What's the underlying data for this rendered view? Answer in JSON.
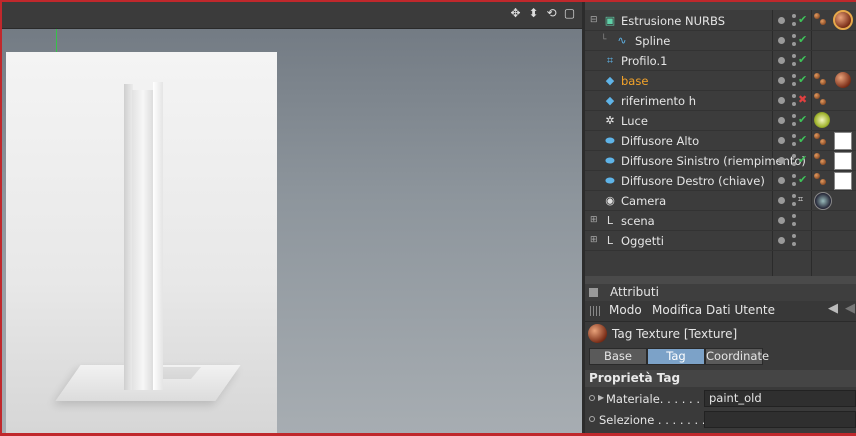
{
  "colors": {
    "window_border": "#c0282c",
    "active_object_text": "#f3a32a",
    "check_green": "#3ec45a",
    "x_red": "#e04040",
    "active_tab": "#7ca2c8"
  },
  "viewport": {
    "toolbar_icons": [
      "move-icon",
      "scale-icon",
      "rotate-icon",
      "maximize-icon"
    ]
  },
  "object_manager": {
    "rows": [
      {
        "name": "Estrusione NURBS",
        "icon": "extrude-nurbs-icon",
        "visible_check": true,
        "tags": [
          "phong-tag",
          "texture-tag-selected"
        ]
      },
      {
        "name": "Spline",
        "icon": "spline-icon",
        "visible_check": true,
        "tags": []
      },
      {
        "name": "Profilo.1",
        "icon": "profile-spline-icon",
        "visible_check": true,
        "tags": []
      },
      {
        "name": "base",
        "icon": "cube-icon",
        "visible_check": true,
        "active": true,
        "tags": [
          "phong-tag",
          "texture-tag"
        ]
      },
      {
        "name": "riferimento h",
        "icon": "cube-icon",
        "visible_check": false,
        "tags": [
          "phong-tag"
        ]
      },
      {
        "name": "Luce",
        "icon": "light-icon",
        "visible_check": true,
        "tags": [
          "light-tag"
        ]
      },
      {
        "name": "Diffusore Alto",
        "icon": "plane-icon",
        "visible_check": true,
        "tags": [
          "phong-tag",
          "white-material-tag"
        ]
      },
      {
        "name": "Diffusore Sinistro (riempimento)",
        "icon": "plane-icon",
        "visible_check": true,
        "tags": [
          "phong-tag",
          "white-material-tag"
        ]
      },
      {
        "name": "Diffusore Destro (chiave)",
        "icon": "plane-icon",
        "visible_check": true,
        "tags": [
          "phong-tag",
          "white-material-tag"
        ]
      },
      {
        "name": "Camera",
        "icon": "camera-icon",
        "visible_check": false,
        "tags": [
          "camera-tag"
        ]
      },
      {
        "name": "scena",
        "icon": "null-icon",
        "visible_check": false,
        "tags": []
      },
      {
        "name": "Oggetti",
        "icon": "null-icon",
        "visible_check": false,
        "tags": []
      }
    ]
  },
  "attributes": {
    "title": "Attributi",
    "menu": {
      "modo": "Modo",
      "modifica": "Modifica",
      "dati_utente": "Dati Utente"
    },
    "tag_name": "Tag Texture [Texture]",
    "tabs": [
      "Base",
      "Tag",
      "Coordinate"
    ],
    "active_tab": "Tag",
    "section_title": "Proprietà Tag",
    "properties": {
      "materiale_label": "Materiale. . . . . . . .",
      "materiale_value": "paint_old",
      "selezione_label": "Selezione . . . . . . . . .",
      "selezione_value": ""
    }
  }
}
